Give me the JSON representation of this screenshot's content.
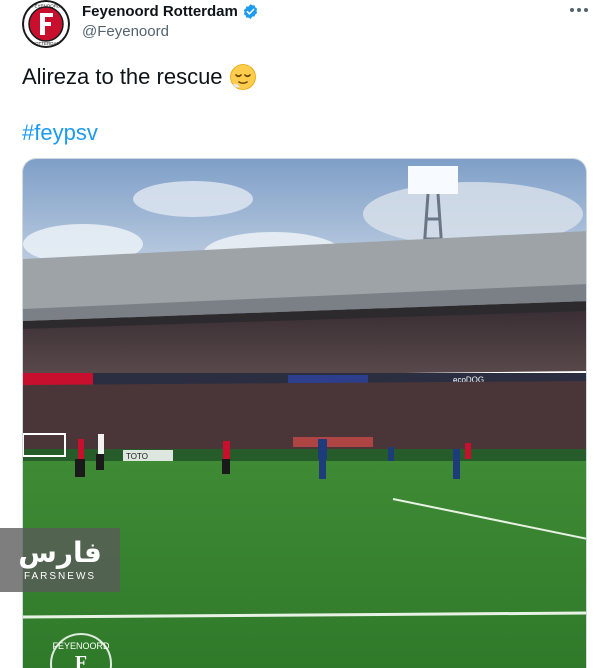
{
  "tweet": {
    "author_name": "Feyenoord Rotterdam",
    "handle": "@Feyenoord",
    "text": "Alireza to the rescue",
    "emoji": "😌",
    "hashtag": "#feypsv"
  },
  "avatar_logo_text": "FEYENOORD ROTTERDAM",
  "icons": {
    "verified": "verified-badge-icon",
    "more": "more-options-icon"
  },
  "video": {
    "scoreboard_text": "FEYENOORD",
    "ad_boards": [
      "TOTO",
      "ecoDOG"
    ]
  },
  "watermark": {
    "logo": "فارس",
    "text": "FARSNEWS"
  },
  "colors": {
    "link": "#1d9bf0",
    "verified": "#1d9bf0",
    "club_red": "#c8102e"
  }
}
